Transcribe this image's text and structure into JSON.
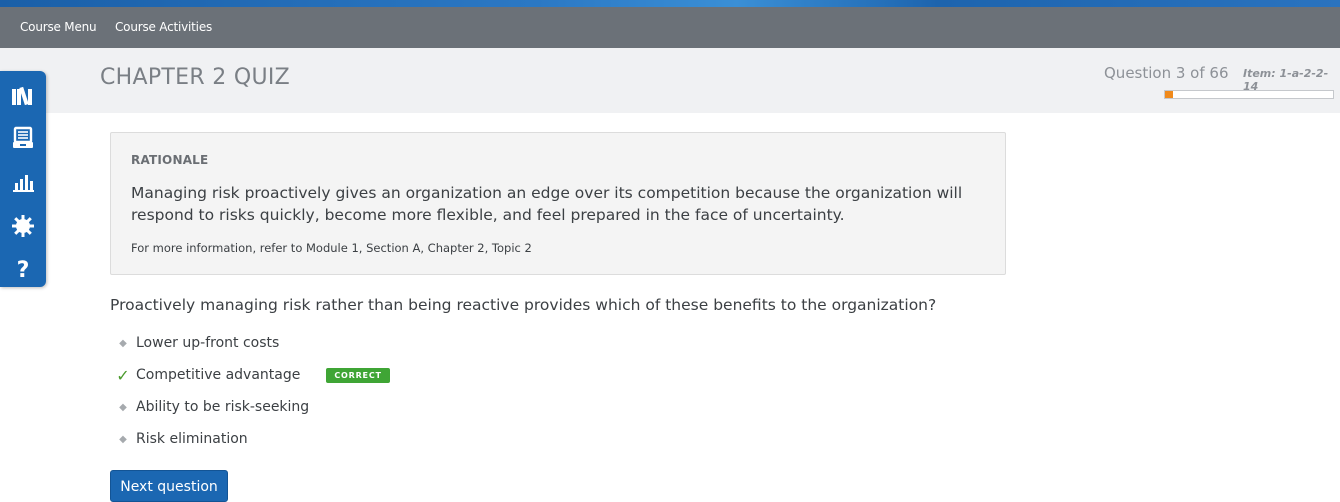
{
  "nav": {
    "items": [
      {
        "label": "Course Menu"
      },
      {
        "label": "Course Activities"
      }
    ]
  },
  "header": {
    "title": "CHAPTER 2 QUIZ",
    "question_counter": "Question 3 of 66",
    "item_id": "Item: 1-a-2-2-14",
    "progress_fraction": 0.0455
  },
  "sidebar": {
    "tools": [
      {
        "icon": "library-icon"
      },
      {
        "icon": "notebook-icon"
      },
      {
        "icon": "bar-chart-icon"
      },
      {
        "icon": "gear-icon"
      },
      {
        "icon": "help-icon"
      }
    ]
  },
  "rationale": {
    "heading": "RATIONALE",
    "body": "Managing risk proactively gives an organization an edge over its competition because the organization will respond to risks quickly, become more flexible, and feel prepared in the face of uncertainty.",
    "reference": "For more information, refer to Module 1, Section A, Chapter 2, Topic 2"
  },
  "question": {
    "text": "Proactively managing risk rather than being reactive provides which of these benefits to the organization?",
    "options": [
      {
        "label": "Lower up-front costs",
        "correct": false
      },
      {
        "label": "Competitive advantage",
        "correct": true
      },
      {
        "label": "Ability to be risk-seeking",
        "correct": false
      },
      {
        "label": "Risk elimination",
        "correct": false
      }
    ],
    "correct_badge": "CORRECT"
  },
  "actions": {
    "next_label": "Next question"
  },
  "colors": {
    "accent_blue": "#1b67b2",
    "nav_gray": "#6b7178",
    "progress_orange": "#f08a1c",
    "correct_green": "#3fa535"
  }
}
